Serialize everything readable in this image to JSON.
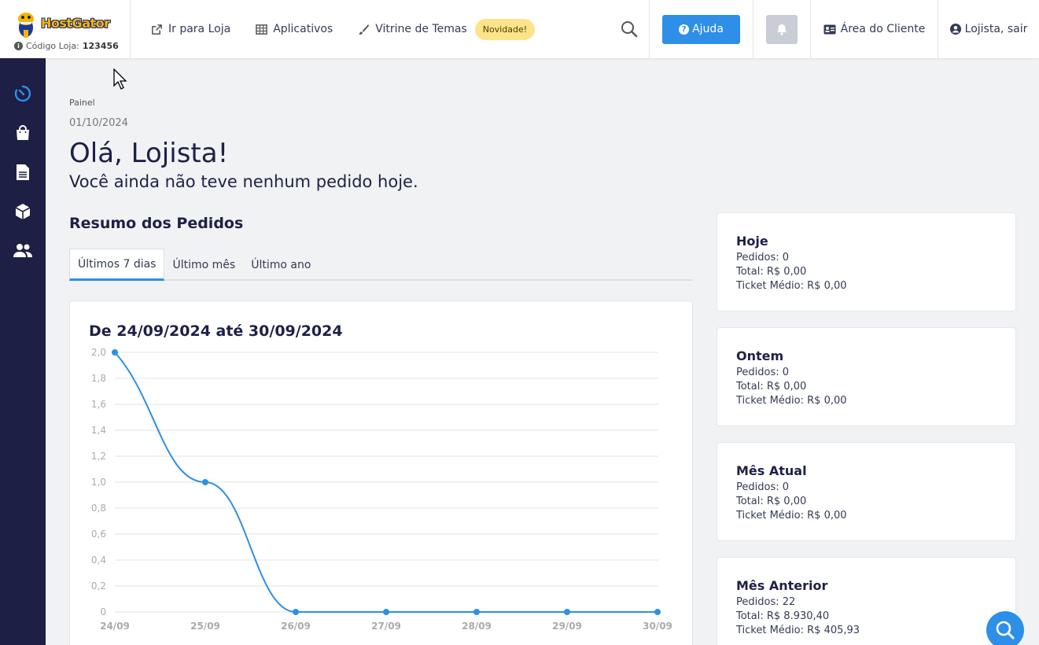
{
  "brand": {
    "name": "HostGator",
    "store_code_label": "Código Loja:",
    "store_code": "123456"
  },
  "nav": {
    "items": [
      {
        "label": "Ir para Loja",
        "icon": "external-link-icon"
      },
      {
        "label": "Aplicativos",
        "icon": "grid-icon"
      },
      {
        "label": "Vitrine de Temas",
        "icon": "brush-icon"
      }
    ],
    "badge": "Novidade!",
    "help_label": "Ajuda",
    "client_area": "Área do Cliente",
    "user": "Lojista, sair"
  },
  "sidebar": {
    "items": [
      "dashboard-icon",
      "shopping-bag-icon",
      "document-icon",
      "box-icon",
      "users-icon"
    ]
  },
  "page": {
    "breadcrumb": "Painel",
    "date": "01/10/2024",
    "greeting": "Olá, Lojista!",
    "subtitle": "Você ainda não teve nenhum pedido hoje.",
    "section_title": "Resumo dos Pedidos",
    "tabs": [
      "Últimos 7 dias",
      "Último mês",
      "Último ano"
    ]
  },
  "stats": [
    {
      "title": "Hoje",
      "orders": "Pedidos: 0",
      "total": "Total: R$ 0,00",
      "ticket": "Ticket Médio: R$ 0,00"
    },
    {
      "title": "Ontem",
      "orders": "Pedidos: 0",
      "total": "Total: R$ 0,00",
      "ticket": "Ticket Médio: R$ 0,00"
    },
    {
      "title": "Mês Atual",
      "orders": "Pedidos: 0",
      "total": "Total: R$ 0,00",
      "ticket": "Ticket Médio: R$ 0,00"
    },
    {
      "title": "Mês Anterior",
      "orders": "Pedidos: 22",
      "total": "Total: R$ 8.930,40",
      "ticket": "Ticket Médio: R$ 405,93"
    }
  ],
  "colors": {
    "accent": "#2d8fe8",
    "sidebar": "#1d1f45",
    "badge": "#ffe38a"
  },
  "chart_data": {
    "type": "line",
    "title": "De 24/09/2024 até 30/09/2024",
    "categories": [
      "24/09",
      "25/09",
      "26/09",
      "27/09",
      "28/09",
      "29/09",
      "30/09"
    ],
    "values": [
      2,
      1,
      0,
      0,
      0,
      0,
      0
    ],
    "ylim": [
      0,
      2
    ],
    "yticks": [
      "0",
      "0,2",
      "0,4",
      "0,6",
      "0,8",
      "1,0",
      "1,2",
      "1,4",
      "1,6",
      "1,8",
      "2,0"
    ],
    "grid": true,
    "color": "#2d8fe8"
  }
}
